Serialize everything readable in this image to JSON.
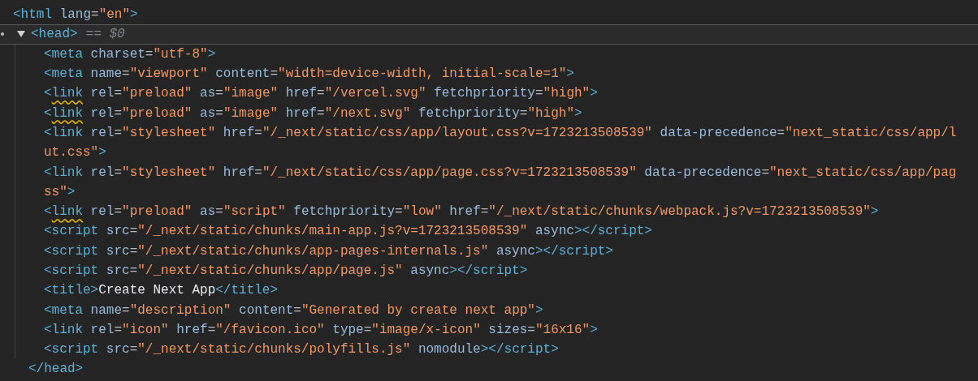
{
  "tree": {
    "selected": false,
    "tokens": [
      {
        "kind": "tag",
        "t": "<html"
      },
      {
        "kind": "attr",
        "t": " lang"
      },
      {
        "kind": "punct",
        "t": "="
      },
      {
        "kind": "value",
        "t": "\"en\""
      },
      {
        "kind": "tag",
        "t": ">"
      }
    ],
    "children": [
      {
        "selected": true,
        "expanded": true,
        "console_ref": "== $0",
        "tokens": [
          {
            "kind": "tag",
            "t": "<head>"
          }
        ],
        "children": [
          {
            "selected": false,
            "tokens": [
              {
                "kind": "tag",
                "t": "<meta"
              },
              {
                "kind": "attr",
                "t": " charset"
              },
              {
                "kind": "punct",
                "t": "="
              },
              {
                "kind": "value",
                "t": "\"utf-8\""
              },
              {
                "kind": "tag",
                "t": ">"
              }
            ]
          },
          {
            "selected": false,
            "tokens": [
              {
                "kind": "tag",
                "t": "<meta"
              },
              {
                "kind": "attr",
                "t": " name"
              },
              {
                "kind": "punct",
                "t": "="
              },
              {
                "kind": "value",
                "t": "\"viewport\""
              },
              {
                "kind": "attr",
                "t": " content"
              },
              {
                "kind": "punct",
                "t": "="
              },
              {
                "kind": "value",
                "t": "\"width=device-width, initial-scale=1\""
              },
              {
                "kind": "tag",
                "t": ">"
              }
            ]
          },
          {
            "selected": false,
            "tokens": [
              {
                "kind": "tag",
                "t": "<"
              },
              {
                "kind": "tag",
                "t": "link",
                "warning": true
              },
              {
                "kind": "attr",
                "t": " rel"
              },
              {
                "kind": "punct",
                "t": "="
              },
              {
                "kind": "value",
                "t": "\"preload\""
              },
              {
                "kind": "attr",
                "t": " as"
              },
              {
                "kind": "punct",
                "t": "="
              },
              {
                "kind": "value",
                "t": "\"image\""
              },
              {
                "kind": "attr",
                "t": " href"
              },
              {
                "kind": "punct",
                "t": "="
              },
              {
                "kind": "value",
                "t": "\"/vercel.svg\""
              },
              {
                "kind": "attr",
                "t": " fetchpriority"
              },
              {
                "kind": "punct",
                "t": "="
              },
              {
                "kind": "value",
                "t": "\"high\""
              },
              {
                "kind": "tag",
                "t": ">"
              }
            ]
          },
          {
            "selected": false,
            "tokens": [
              {
                "kind": "tag",
                "t": "<"
              },
              {
                "kind": "tag",
                "t": "link",
                "warning": true
              },
              {
                "kind": "attr",
                "t": " rel"
              },
              {
                "kind": "punct",
                "t": "="
              },
              {
                "kind": "value",
                "t": "\"preload\""
              },
              {
                "kind": "attr",
                "t": " as"
              },
              {
                "kind": "punct",
                "t": "="
              },
              {
                "kind": "value",
                "t": "\"image\""
              },
              {
                "kind": "attr",
                "t": " href"
              },
              {
                "kind": "punct",
                "t": "="
              },
              {
                "kind": "value",
                "t": "\"/next.svg\""
              },
              {
                "kind": "attr",
                "t": " fetchpriority"
              },
              {
                "kind": "punct",
                "t": "="
              },
              {
                "kind": "value",
                "t": "\"high\""
              },
              {
                "kind": "tag",
                "t": ">"
              }
            ]
          },
          {
            "selected": false,
            "tokens": [
              {
                "kind": "tag",
                "t": "<link"
              },
              {
                "kind": "attr",
                "t": " rel"
              },
              {
                "kind": "punct",
                "t": "="
              },
              {
                "kind": "value",
                "t": "\"stylesheet\""
              },
              {
                "kind": "attr",
                "t": " href"
              },
              {
                "kind": "punct",
                "t": "="
              },
              {
                "kind": "value",
                "t": "\"/_next/static/css/app/layout.css?v=1723213508539\""
              },
              {
                "kind": "attr",
                "t": " data-precedence"
              },
              {
                "kind": "punct",
                "t": "="
              },
              {
                "kind": "value",
                "t": "\"next_static/css/app/l"
              }
            ],
            "wrap": [
              {
                "kind": "value",
                "t": "ut.css\""
              },
              {
                "kind": "tag",
                "t": ">"
              }
            ]
          },
          {
            "selected": false,
            "tokens": [
              {
                "kind": "tag",
                "t": "<link"
              },
              {
                "kind": "attr",
                "t": " rel"
              },
              {
                "kind": "punct",
                "t": "="
              },
              {
                "kind": "value",
                "t": "\"stylesheet\""
              },
              {
                "kind": "attr",
                "t": " href"
              },
              {
                "kind": "punct",
                "t": "="
              },
              {
                "kind": "value",
                "t": "\"/_next/static/css/app/page.css?v=1723213508539\""
              },
              {
                "kind": "attr",
                "t": " data-precedence"
              },
              {
                "kind": "punct",
                "t": "="
              },
              {
                "kind": "value",
                "t": "\"next_static/css/app/pag"
              }
            ],
            "wrap": [
              {
                "kind": "value",
                "t": "ss\""
              },
              {
                "kind": "tag",
                "t": ">"
              }
            ]
          },
          {
            "selected": false,
            "tokens": [
              {
                "kind": "tag",
                "t": "<"
              },
              {
                "kind": "tag",
                "t": "link",
                "warning": true
              },
              {
                "kind": "attr",
                "t": " rel"
              },
              {
                "kind": "punct",
                "t": "="
              },
              {
                "kind": "value",
                "t": "\"preload\""
              },
              {
                "kind": "attr",
                "t": " as"
              },
              {
                "kind": "punct",
                "t": "="
              },
              {
                "kind": "value",
                "t": "\"script\""
              },
              {
                "kind": "attr",
                "t": " fetchpriority"
              },
              {
                "kind": "punct",
                "t": "="
              },
              {
                "kind": "value",
                "t": "\"low\""
              },
              {
                "kind": "attr",
                "t": " href"
              },
              {
                "kind": "punct",
                "t": "="
              },
              {
                "kind": "value",
                "t": "\"/_next/static/chunks/webpack.js?v=1723213508539\""
              },
              {
                "kind": "tag",
                "t": ">"
              }
            ]
          },
          {
            "selected": false,
            "tokens": [
              {
                "kind": "tag",
                "t": "<script"
              },
              {
                "kind": "attr",
                "t": " src"
              },
              {
                "kind": "punct",
                "t": "="
              },
              {
                "kind": "value",
                "t": "\"/_next/static/chunks/main-app.js?v=1723213508539\""
              },
              {
                "kind": "attr",
                "t": " async"
              },
              {
                "kind": "tag",
                "t": "></script>"
              }
            ]
          },
          {
            "selected": false,
            "tokens": [
              {
                "kind": "tag",
                "t": "<script"
              },
              {
                "kind": "attr",
                "t": " src"
              },
              {
                "kind": "punct",
                "t": "="
              },
              {
                "kind": "value",
                "t": "\"/_next/static/chunks/app-pages-internals.js\""
              },
              {
                "kind": "attr",
                "t": " async"
              },
              {
                "kind": "tag",
                "t": "></script>"
              }
            ]
          },
          {
            "selected": false,
            "tokens": [
              {
                "kind": "tag",
                "t": "<script"
              },
              {
                "kind": "attr",
                "t": " src"
              },
              {
                "kind": "punct",
                "t": "="
              },
              {
                "kind": "value",
                "t": "\"/_next/static/chunks/app/page.js\""
              },
              {
                "kind": "attr",
                "t": " async"
              },
              {
                "kind": "tag",
                "t": "></script>"
              }
            ]
          },
          {
            "selected": false,
            "tokens": [
              {
                "kind": "tag",
                "t": "<title>"
              },
              {
                "kind": "text",
                "t": "Create Next App"
              },
              {
                "kind": "tag",
                "t": "</title>"
              }
            ]
          },
          {
            "selected": false,
            "tokens": [
              {
                "kind": "tag",
                "t": "<meta"
              },
              {
                "kind": "attr",
                "t": " name"
              },
              {
                "kind": "punct",
                "t": "="
              },
              {
                "kind": "value",
                "t": "\"description\""
              },
              {
                "kind": "attr",
                "t": " content"
              },
              {
                "kind": "punct",
                "t": "="
              },
              {
                "kind": "value",
                "t": "\"Generated by create next app\""
              },
              {
                "kind": "tag",
                "t": ">"
              }
            ]
          },
          {
            "selected": false,
            "tokens": [
              {
                "kind": "tag",
                "t": "<link"
              },
              {
                "kind": "attr",
                "t": " rel"
              },
              {
                "kind": "punct",
                "t": "="
              },
              {
                "kind": "value",
                "t": "\"icon\""
              },
              {
                "kind": "attr",
                "t": " href"
              },
              {
                "kind": "punct",
                "t": "="
              },
              {
                "kind": "value",
                "t": "\"/favicon.ico\""
              },
              {
                "kind": "attr",
                "t": " type"
              },
              {
                "kind": "punct",
                "t": "="
              },
              {
                "kind": "value",
                "t": "\"image/x-icon\""
              },
              {
                "kind": "attr",
                "t": " sizes"
              },
              {
                "kind": "punct",
                "t": "="
              },
              {
                "kind": "value",
                "t": "\"16x16\""
              },
              {
                "kind": "tag",
                "t": ">"
              }
            ]
          },
          {
            "selected": false,
            "tokens": [
              {
                "kind": "tag",
                "t": "<script"
              },
              {
                "kind": "attr",
                "t": " src"
              },
              {
                "kind": "punct",
                "t": "="
              },
              {
                "kind": "value",
                "t": "\"/_next/static/chunks/polyfills.js\""
              },
              {
                "kind": "attr",
                "t": " nomodule"
              },
              {
                "kind": "tag",
                "t": "></script>"
              }
            ]
          }
        ],
        "closing": [
          {
            "kind": "tag",
            "t": "</head>"
          }
        ]
      }
    ]
  }
}
